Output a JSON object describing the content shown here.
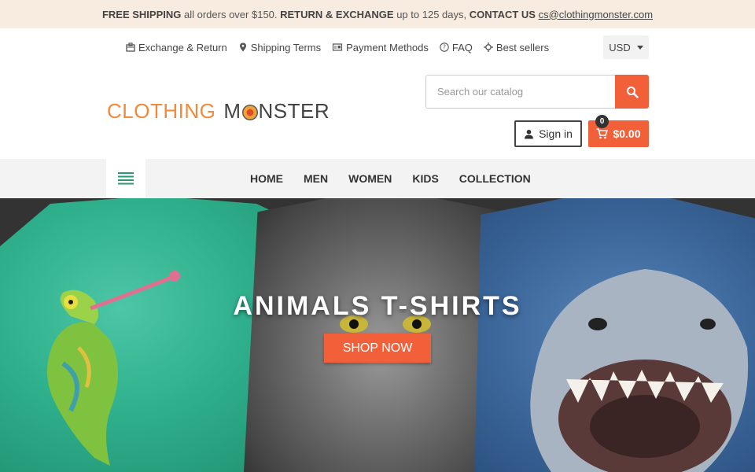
{
  "announcement": {
    "part1_bold": "FREE SHIPPING",
    "part1_text": " all orders over $150. ",
    "part2_bold": "RETURN & EXCHANGE",
    "part2_text": " up to 125 days, ",
    "part3_bold": "CONTACT US",
    "email": "cs@clothingmonster.com"
  },
  "top_nav": {
    "exchange": "Exchange & Return",
    "shipping": "Shipping Terms",
    "payment": "Payment Methods",
    "faq": "FAQ",
    "best": "Best sellers"
  },
  "currency": {
    "selected": "USD"
  },
  "logo": {
    "part1": "CLOTHING",
    "part2a": "M",
    "part2b": "NSTER"
  },
  "search": {
    "placeholder": "Search our catalog",
    "value": ""
  },
  "account": {
    "signin_label": "Sign in"
  },
  "cart": {
    "count": "0",
    "total": "$0.00"
  },
  "main_nav": {
    "home": "HOME",
    "men": "MEN",
    "women": "WOMEN",
    "kids": "KIDS",
    "collection": "COLLECTION"
  },
  "hero": {
    "title": "ANIMALS T-SHIRTS",
    "cta": "SHOP NOW"
  },
  "colors": {
    "accent": "#f2603a",
    "logo_orange": "#f08a3c",
    "announce_bg": "#f8ece0"
  },
  "icons": [
    "exchange-icon",
    "location-pin-icon",
    "payment-card-icon",
    "question-icon",
    "crosshair-icon",
    "search-icon",
    "user-icon",
    "cart-icon",
    "hamburger-menu-icon"
  ]
}
